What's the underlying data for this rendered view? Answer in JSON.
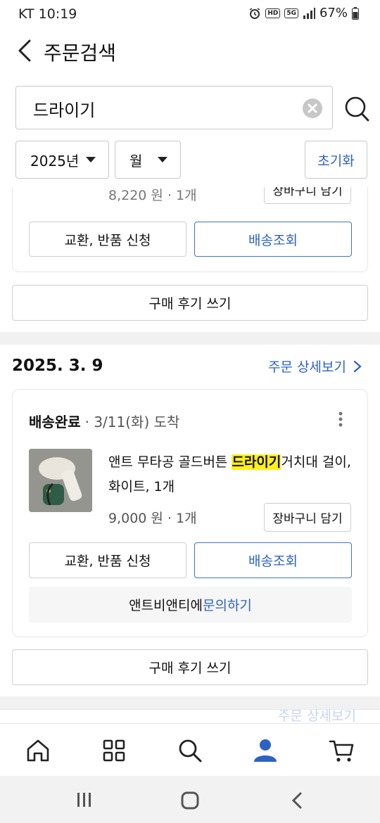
{
  "status": {
    "carrier_time": "KT 10:19",
    "hd_badge": "HD",
    "net_badge": "5G",
    "battery": "67%"
  },
  "header": {
    "title": "주문검색"
  },
  "search": {
    "query": "드라이기"
  },
  "filters": {
    "year": "2025년",
    "month": "월",
    "reset_label": "초기화"
  },
  "prev_order": {
    "price_qty": "8,220 원 · 1개",
    "cart_label": "장바구니 담기",
    "exchange_label": "교환, 반품 신청",
    "track_label": "배송조회",
    "review_label": "구매 후기 쓰기"
  },
  "order": {
    "date": "2025. 3. 9",
    "detail_link": "주문 상세보기",
    "status": "배송완료",
    "arrival": "· 3/11(화) 도착",
    "product_prefix": "앤트 무타공 골드버튼 ",
    "product_highlight": "드라이기",
    "product_suffix": "거치대 걸이,",
    "product_line2": "화이트, 1개",
    "price_qty": "9,000 원 · 1개",
    "cart_label": "장바구니 담기",
    "exchange_label": "교환, 반품 신청",
    "track_label": "배송조회",
    "seller_prefix": "앤트비앤티에 ",
    "seller_link": "문의하기",
    "review_label": "구매 후기 쓰기"
  },
  "next_order": {
    "partial_text": "주문 상세보기"
  },
  "colors": {
    "accent": "#2c62c4",
    "highlight": "#ffef1a",
    "nav_active": "#2c62c4"
  },
  "bottom_nav": [
    "home-icon",
    "category-grid-icon",
    "search-icon",
    "my-account-icon",
    "cart-icon"
  ]
}
